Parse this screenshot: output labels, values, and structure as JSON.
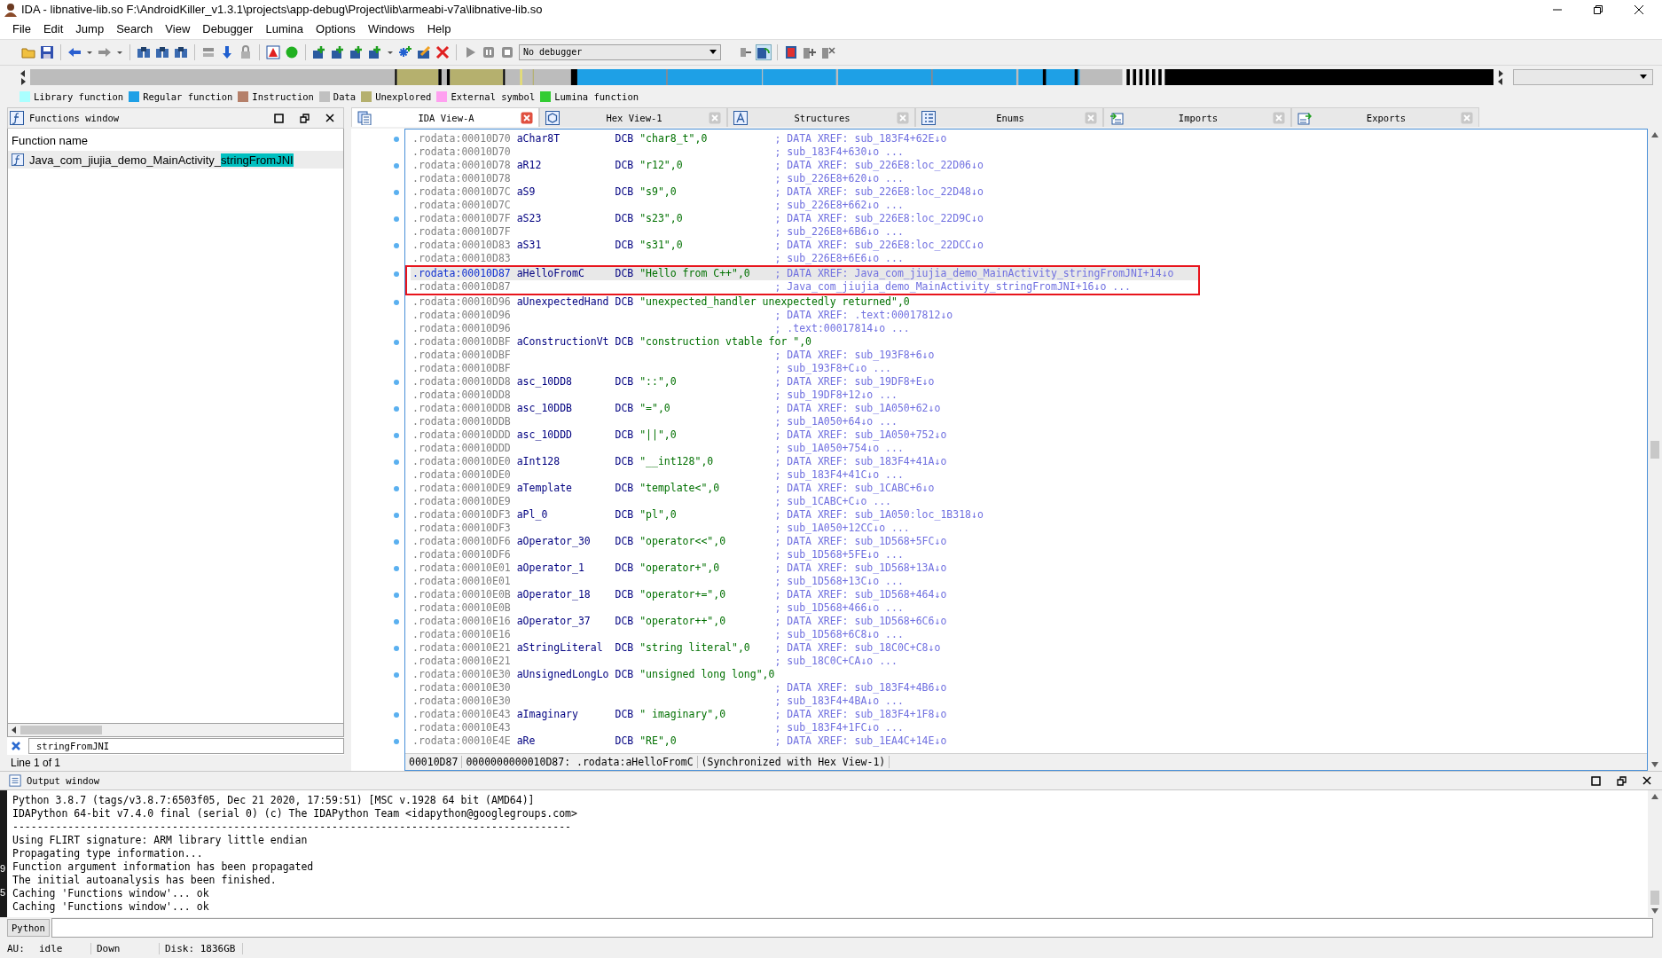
{
  "window": {
    "title": "IDA - libnative-lib.so F:\\AndroidKiller_v1.3.1\\projects\\app-debug\\Project\\lib\\armeabi-v7a\\libnative-lib.so"
  },
  "menu": [
    "File",
    "Edit",
    "Jump",
    "Search",
    "View",
    "Debugger",
    "Lumina",
    "Options",
    "Windows",
    "Help"
  ],
  "toolbar": {
    "debugger_select": "No debugger"
  },
  "legend": [
    {
      "label": "Library function",
      "color": "#aaffff"
    },
    {
      "label": "Regular function",
      "color": "#1ea0e6"
    },
    {
      "label": "Instruction",
      "color": "#b5806a"
    },
    {
      "label": "Data",
      "color": "#c0c0c0"
    },
    {
      "label": "Unexplored",
      "color": "#b5b06e"
    },
    {
      "label": "External symbol",
      "color": "#ffa0f0"
    },
    {
      "label": "Lumina function",
      "color": "#33cc33"
    }
  ],
  "functions_window": {
    "title": "Functions window",
    "column": "Function name",
    "items": [
      {
        "name": "Java_com_jiujia_demo_MainActivity_",
        "match": "stringFromJNI",
        "selected": true
      }
    ],
    "filter": "stringFromJNI",
    "line_count": "Line 1 of 1"
  },
  "tabs": [
    {
      "label": "IDA View-A",
      "kind": "disasm",
      "selected": true
    },
    {
      "label": "Hex View-1",
      "kind": "hex",
      "selected": false
    },
    {
      "label": "Structures",
      "kind": "struct",
      "selected": false
    },
    {
      "label": "Enums",
      "kind": "enum",
      "selected": false
    },
    {
      "label": "Imports",
      "kind": "import",
      "selected": false
    },
    {
      "label": "Exports",
      "kind": "export",
      "selected": false
    }
  ],
  "listing": {
    "rows": [
      {
        "address": ".rodata:00010D70",
        "label": "aChar8T",
        "mnemonic": "DCB",
        "operand": "\"char8_t\",0",
        "comment": "; DATA XREF: sub_183F4+62E↓o",
        "selected": false,
        "boxed": false
      },
      {
        "address": ".rodata:00010D70",
        "comment": "; sub_183F4+630↓o ...",
        "selected": false,
        "boxed": false
      },
      {
        "address": ".rodata:00010D78",
        "label": "aR12",
        "mnemonic": "DCB",
        "operand": "\"r12\",0",
        "comment": "; DATA XREF: sub_226E8:loc_22D06↓o",
        "selected": false,
        "boxed": false
      },
      {
        "address": ".rodata:00010D78",
        "comment": "; sub_226E8+620↓o ...",
        "selected": false,
        "boxed": false
      },
      {
        "address": ".rodata:00010D7C",
        "label": "aS9",
        "mnemonic": "DCB",
        "operand": "\"s9\",0",
        "comment": "; DATA XREF: sub_226E8:loc_22D48↓o",
        "selected": false,
        "boxed": false
      },
      {
        "address": ".rodata:00010D7C",
        "comment": "; sub_226E8+662↓o ...",
        "selected": false,
        "boxed": false
      },
      {
        "address": ".rodata:00010D7F",
        "label": "aS23",
        "mnemonic": "DCB",
        "operand": "\"s23\",0",
        "comment": "; DATA XREF: sub_226E8:loc_22D9C↓o",
        "selected": false,
        "boxed": false
      },
      {
        "address": ".rodata:00010D7F",
        "comment": "; sub_226E8+6B6↓o ...",
        "selected": false,
        "boxed": false
      },
      {
        "address": ".rodata:00010D83",
        "label": "aS31",
        "mnemonic": "DCB",
        "operand": "\"s31\",0",
        "comment": "; DATA XREF: sub_226E8:loc_22DCC↓o",
        "selected": false,
        "boxed": false
      },
      {
        "address": ".rodata:00010D83",
        "comment": "; sub_226E8+6E6↓o ...",
        "selected": false,
        "boxed": false
      },
      {
        "address": ".rodata:00010D87",
        "label": "aHelloFromC",
        "mnemonic": "DCB",
        "operand": "\"Hello from C++\",0",
        "comment": "; DATA XREF: Java_com_jiujia_demo_MainActivity_stringFromJNI+14↓o",
        "selected": true,
        "boxed": true
      },
      {
        "address": ".rodata:00010D87",
        "comment": "; Java_com_jiujia_demo_MainActivity_stringFromJNI+16↓o ...",
        "selected": false,
        "boxed": true
      },
      {
        "address": ".rodata:00010D96",
        "label": "aUnexpectedHand",
        "mnemonic": "DCB",
        "operand": "\"unexpected_handler unexpectedly returned\",0",
        "selected": false,
        "boxed": false
      },
      {
        "address": ".rodata:00010D96",
        "comment": "; DATA XREF: .text:00017812↓o",
        "selected": false,
        "boxed": false
      },
      {
        "address": ".rodata:00010D96",
        "comment": "; .text:00017814↓o ...",
        "selected": false,
        "boxed": false
      },
      {
        "address": ".rodata:00010DBF",
        "label": "aConstructionVt",
        "mnemonic": "DCB",
        "operand": "\"construction vtable for \",0",
        "selected": false,
        "boxed": false
      },
      {
        "address": ".rodata:00010DBF",
        "comment": "; DATA XREF: sub_193F8+6↓o",
        "selected": false,
        "boxed": false
      },
      {
        "address": ".rodata:00010DBF",
        "comment": "; sub_193F8+C↓o ...",
        "selected": false,
        "boxed": false
      },
      {
        "address": ".rodata:00010DD8",
        "label": "asc_10DD8",
        "mnemonic": "DCB",
        "operand": "\"::\",0",
        "comment": "; DATA XREF: sub_19DF8+E↓o",
        "selected": false,
        "boxed": false
      },
      {
        "address": ".rodata:00010DD8",
        "comment": "; sub_19DF8+12↓o ...",
        "selected": false,
        "boxed": false
      },
      {
        "address": ".rodata:00010DDB",
        "label": "asc_10DDB",
        "mnemonic": "DCB",
        "operand": "\"=\",0",
        "comment": "; DATA XREF: sub_1A050+62↓o",
        "selected": false,
        "boxed": false
      },
      {
        "address": ".rodata:00010DDB",
        "comment": "; sub_1A050+64↓o ...",
        "selected": false,
        "boxed": false
      },
      {
        "address": ".rodata:00010DDD",
        "label": "asc_10DDD",
        "mnemonic": "DCB",
        "operand": "\"||\",0",
        "comment": "; DATA XREF: sub_1A050+752↓o",
        "selected": false,
        "boxed": false
      },
      {
        "address": ".rodata:00010DDD",
        "comment": "; sub_1A050+754↓o ...",
        "selected": false,
        "boxed": false
      },
      {
        "address": ".rodata:00010DE0",
        "label": "aInt128",
        "mnemonic": "DCB",
        "operand": "\"__int128\",0",
        "comment": "; DATA XREF: sub_183F4+41A↓o",
        "selected": false,
        "boxed": false
      },
      {
        "address": ".rodata:00010DE0",
        "comment": "; sub_183F4+41C↓o ...",
        "selected": false,
        "boxed": false
      },
      {
        "address": ".rodata:00010DE9",
        "label": "aTemplate",
        "mnemonic": "DCB",
        "operand": "\"template<\",0",
        "comment": "; DATA XREF: sub_1CABC+6↓o",
        "selected": false,
        "boxed": false
      },
      {
        "address": ".rodata:00010DE9",
        "comment": "; sub_1CABC+C↓o ...",
        "selected": false,
        "boxed": false
      },
      {
        "address": ".rodata:00010DF3",
        "label": "aPl_0",
        "mnemonic": "DCB",
        "operand": "\"pl\",0",
        "comment": "; DATA XREF: sub_1A050:loc_1B318↓o",
        "selected": false,
        "boxed": false
      },
      {
        "address": ".rodata:00010DF3",
        "comment": "; sub_1A050+12CC↓o ...",
        "selected": false,
        "boxed": false
      },
      {
        "address": ".rodata:00010DF6",
        "label": "aOperator_30",
        "mnemonic": "DCB",
        "operand": "\"operator<<\",0",
        "comment": "; DATA XREF: sub_1D568+5FC↓o",
        "selected": false,
        "boxed": false
      },
      {
        "address": ".rodata:00010DF6",
        "comment": "; sub_1D568+5FE↓o ...",
        "selected": false,
        "boxed": false
      },
      {
        "address": ".rodata:00010E01",
        "label": "aOperator_1",
        "mnemonic": "DCB",
        "operand": "\"operator+\",0",
        "comment": "; DATA XREF: sub_1D568+13A↓o",
        "selected": false,
        "boxed": false
      },
      {
        "address": ".rodata:00010E01",
        "comment": "; sub_1D568+13C↓o ...",
        "selected": false,
        "boxed": false
      },
      {
        "address": ".rodata:00010E0B",
        "label": "aOperator_18",
        "mnemonic": "DCB",
        "operand": "\"operator+=\",0",
        "comment": "; DATA XREF: sub_1D568+464↓o",
        "selected": false,
        "boxed": false
      },
      {
        "address": ".rodata:00010E0B",
        "comment": "; sub_1D568+466↓o ...",
        "selected": false,
        "boxed": false
      },
      {
        "address": ".rodata:00010E16",
        "label": "aOperator_37",
        "mnemonic": "DCB",
        "operand": "\"operator++\",0",
        "comment": "; DATA XREF: sub_1D568+6C6↓o",
        "selected": false,
        "boxed": false
      },
      {
        "address": ".rodata:00010E16",
        "comment": "; sub_1D568+6C8↓o ...",
        "selected": false,
        "boxed": false
      },
      {
        "address": ".rodata:00010E21",
        "label": "aStringLiteral",
        "mnemonic": "DCB",
        "operand": "\"string literal\",0",
        "comment": "; DATA XREF: sub_18C0C+C8↓o",
        "selected": false,
        "boxed": false
      },
      {
        "address": ".rodata:00010E21",
        "comment": "; sub_18C0C+CA↓o ...",
        "selected": false,
        "boxed": false
      },
      {
        "address": ".rodata:00010E30",
        "label": "aUnsignedLongLo",
        "mnemonic": "DCB",
        "operand": "\"unsigned long long\",0",
        "selected": false,
        "boxed": false
      },
      {
        "address": ".rodata:00010E30",
        "comment": "; DATA XREF: sub_183F4+4B6↓o",
        "selected": false,
        "boxed": false
      },
      {
        "address": ".rodata:00010E30",
        "comment": "; sub_183F4+4BA↓o ...",
        "selected": false,
        "boxed": false
      },
      {
        "address": ".rodata:00010E43",
        "label": "aImaginary",
        "mnemonic": "DCB",
        "operand": "\" imaginary\",0",
        "comment": "; DATA XREF: sub_183F4+1F8↓o",
        "selected": false,
        "boxed": false
      },
      {
        "address": ".rodata:00010E43",
        "comment": "; sub_183F4+1FC↓o ...",
        "selected": false,
        "boxed": false
      },
      {
        "address": ".rodata:00010E4E",
        "label": "aRe",
        "mnemonic": "DCB",
        "operand": "\"RE\",0",
        "comment": "; DATA XREF: sub_1EA4C+14E↓o",
        "selected": false,
        "boxed": false
      }
    ],
    "status": [
      "00010D87",
      "0000000000010D87: .rodata:aHelloFromC",
      "(Synchronized with Hex View-1)"
    ]
  },
  "output": {
    "title": "Output window",
    "lines": [
      "Python 3.8.7 (tags/v3.8.7:6503f05, Dec 21 2020, 17:59:51) [MSC v.1928 64 bit (AMD64)]",
      "IDAPython 64-bit v7.4.0 final (serial 0) (c) The IDAPython Team <idapython@googlegroups.com>",
      "-------------------------------------------------------------------------------------------",
      "Using FLIRT signature: ARM library little endian",
      "Propagating type information...",
      "Function argument information has been propagated",
      "The initial autoanalysis has been finished.",
      "Caching 'Functions window'... ok",
      "Caching 'Functions window'... ok"
    ],
    "input_label": "Python"
  },
  "status_bar": [
    "AU:",
    "idle",
    "Down",
    "Disk: 1836GB"
  ],
  "edge_digits": [
    "9",
    "5"
  ]
}
